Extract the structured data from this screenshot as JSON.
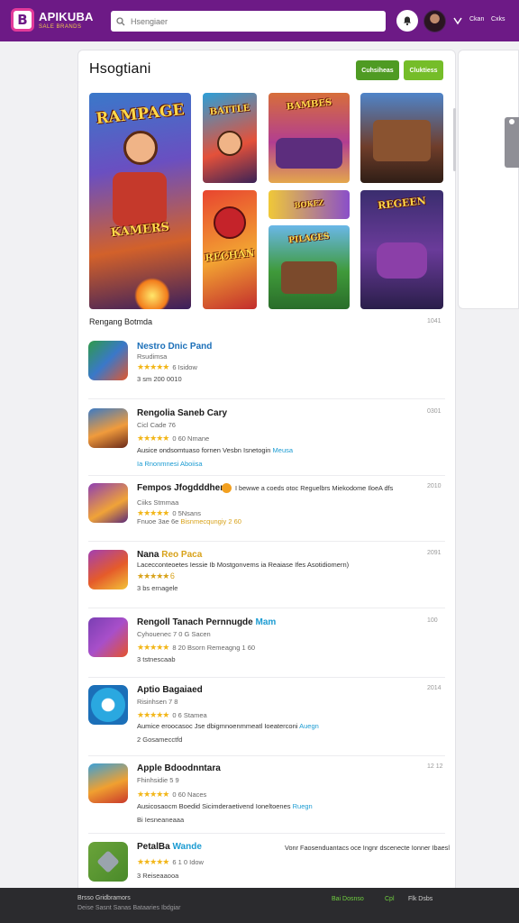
{
  "app": {
    "title": "APIKUBA",
    "subtitle": "SALE BRANDS"
  },
  "search": {
    "placeholder": "Hsengiaer",
    "value": ""
  },
  "topbar": {
    "nav": [
      "Ckan",
      "Cxks"
    ]
  },
  "main": {
    "heading": "Hsogtiani",
    "buttons": [
      "Cuhsiheas",
      "Cluktiess"
    ],
    "featured_labels": [
      "RAMPAGE",
      "KAMERS",
      "BATTLE",
      "BAMBES",
      "RECHAN",
      "BOKEZ",
      "PILAGES",
      "REGEEN"
    ],
    "section_title": "Rengang Botmda",
    "section_count": "1041"
  },
  "apps": [
    {
      "name": "Nestro Dnic Pand",
      "tag": "",
      "line1": "Rsudimsa",
      "rating": "★★★★★",
      "rating_note": "6 Isidow",
      "extra": "",
      "extra_link": "",
      "downloads": "3 sm 200 0010",
      "time": ""
    },
    {
      "name": "Rengolia Saneb Cary",
      "tag": "",
      "line1": "Cicl Cade 76",
      "rating": "★★★★★",
      "rating_note": "0 60 Nmane",
      "extra": "Ausice ondsomtuaso fornen Vesbn Isnetogin",
      "extra_link": "Meusa",
      "downloads": "",
      "downloads_link": "Ia Rnonmnesi Aboiisa",
      "time": "0301"
    },
    {
      "name": "Fempos Jfogdddhen",
      "tag": "",
      "line1": "Ciiks Stmmaa",
      "rating": "★★★★★",
      "rating_note": "0 5Nsans",
      "extra": "Fnuoe 3ae 6e",
      "extra_link": "Bisnmecqungiy 2 60",
      "downloads": "",
      "desc_right": "I bewwe a coeds otoc Reguelbrs Miekodome IloeA dfs",
      "time": "2010"
    },
    {
      "name": "Nana",
      "tag": "Reo Paca",
      "line1": "Lacecconteoetes Iessie Ib Mostgonvems ia Reaiase Ifes Asotidiomern)",
      "rating": "★★★★★ 6",
      "rating_note": "",
      "extra": "",
      "extra_link": "",
      "downloads": "3 bs ernagele",
      "time": "2091"
    },
    {
      "name": "Rengoll Tanach Pernnugde",
      "tag": "Mam",
      "line1": "Cyhouenec 7 0 G Sacen",
      "rating": "★★★★★",
      "rating_note": "8 20 Bsorn Remeagng 1 60",
      "extra": "",
      "extra_link": "",
      "downloads": "3 tstnescaab",
      "time": "100"
    },
    {
      "name": "Aptio Bagaiaed",
      "tag": "",
      "line1": "Risinhsen 7 8",
      "rating": "★★★★★",
      "rating_note": "0 6 Stamea",
      "extra": "Aumice eroocasoc Jse dbigmnoenmmeatl Ioeaterconi",
      "extra_link": "Auegn",
      "downloads": "2 Gosamecctfd",
      "time": "2014"
    },
    {
      "name": "Apple Bdoodnntara",
      "tag": "",
      "line1": "Fhinhsidie 5 9",
      "rating": "★★★★★",
      "rating_note": "0 60 Naces",
      "extra": "Ausicosaocm Boedid Sicimderaetivend Ioneltoenes",
      "extra_link": "Ruegn",
      "downloads": "Bi Iesneaneaaa",
      "time": "12 12"
    },
    {
      "name": "PetalBa",
      "tag": "Wande",
      "line1": "",
      "rating": "★★★★★",
      "rating_note": "6 1 0 Idow",
      "extra": "",
      "extra_link": "",
      "desc_right": "Vonr Faosenduantacs oce Ingnr dscenecte Ionner Ibaesl",
      "downloads": "3 Reiseaaooa",
      "time": ""
    }
  ],
  "footer": {
    "line1": "Brsso Gridbramors",
    "line2": "Deise Sasnt Sanas Bataaries Ibdgiar",
    "right": [
      "Bai Dosnso",
      "Cpl",
      "Flk Dsbs"
    ]
  },
  "colors": {
    "topbar": "#6d1a86",
    "accent_green": "#4f9b23",
    "accent_green_light": "#75bd29",
    "star": "#f2b618",
    "link": "#1b9bd2"
  }
}
